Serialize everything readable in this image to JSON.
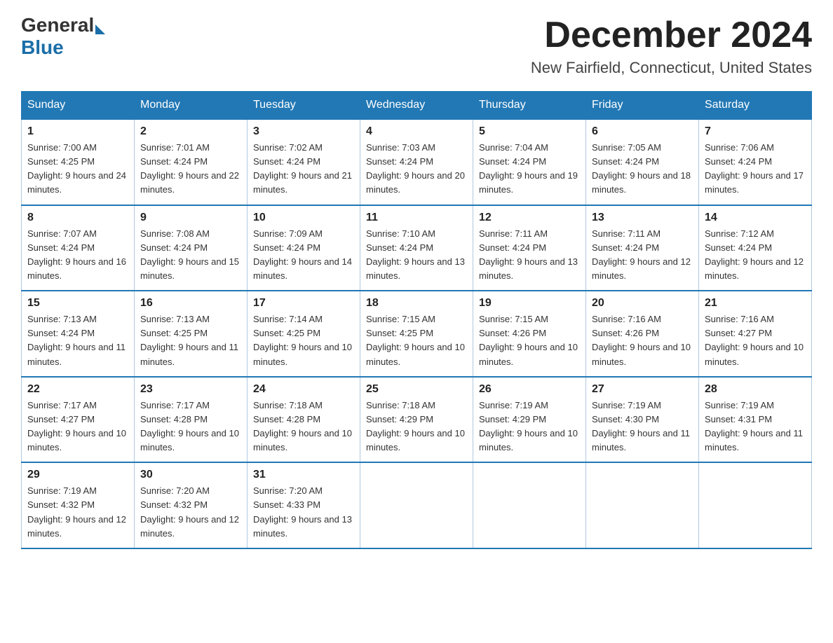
{
  "header": {
    "logo_general": "General",
    "logo_blue": "Blue",
    "month_title": "December 2024",
    "location": "New Fairfield, Connecticut, United States"
  },
  "days_of_week": [
    "Sunday",
    "Monday",
    "Tuesday",
    "Wednesday",
    "Thursday",
    "Friday",
    "Saturday"
  ],
  "weeks": [
    [
      {
        "day": "1",
        "sunrise": "7:00 AM",
        "sunset": "4:25 PM",
        "daylight": "9 hours and 24 minutes."
      },
      {
        "day": "2",
        "sunrise": "7:01 AM",
        "sunset": "4:24 PM",
        "daylight": "9 hours and 22 minutes."
      },
      {
        "day": "3",
        "sunrise": "7:02 AM",
        "sunset": "4:24 PM",
        "daylight": "9 hours and 21 minutes."
      },
      {
        "day": "4",
        "sunrise": "7:03 AM",
        "sunset": "4:24 PM",
        "daylight": "9 hours and 20 minutes."
      },
      {
        "day": "5",
        "sunrise": "7:04 AM",
        "sunset": "4:24 PM",
        "daylight": "9 hours and 19 minutes."
      },
      {
        "day": "6",
        "sunrise": "7:05 AM",
        "sunset": "4:24 PM",
        "daylight": "9 hours and 18 minutes."
      },
      {
        "day": "7",
        "sunrise": "7:06 AM",
        "sunset": "4:24 PM",
        "daylight": "9 hours and 17 minutes."
      }
    ],
    [
      {
        "day": "8",
        "sunrise": "7:07 AM",
        "sunset": "4:24 PM",
        "daylight": "9 hours and 16 minutes."
      },
      {
        "day": "9",
        "sunrise": "7:08 AM",
        "sunset": "4:24 PM",
        "daylight": "9 hours and 15 minutes."
      },
      {
        "day": "10",
        "sunrise": "7:09 AM",
        "sunset": "4:24 PM",
        "daylight": "9 hours and 14 minutes."
      },
      {
        "day": "11",
        "sunrise": "7:10 AM",
        "sunset": "4:24 PM",
        "daylight": "9 hours and 13 minutes."
      },
      {
        "day": "12",
        "sunrise": "7:11 AM",
        "sunset": "4:24 PM",
        "daylight": "9 hours and 13 minutes."
      },
      {
        "day": "13",
        "sunrise": "7:11 AM",
        "sunset": "4:24 PM",
        "daylight": "9 hours and 12 minutes."
      },
      {
        "day": "14",
        "sunrise": "7:12 AM",
        "sunset": "4:24 PM",
        "daylight": "9 hours and 12 minutes."
      }
    ],
    [
      {
        "day": "15",
        "sunrise": "7:13 AM",
        "sunset": "4:24 PM",
        "daylight": "9 hours and 11 minutes."
      },
      {
        "day": "16",
        "sunrise": "7:13 AM",
        "sunset": "4:25 PM",
        "daylight": "9 hours and 11 minutes."
      },
      {
        "day": "17",
        "sunrise": "7:14 AM",
        "sunset": "4:25 PM",
        "daylight": "9 hours and 10 minutes."
      },
      {
        "day": "18",
        "sunrise": "7:15 AM",
        "sunset": "4:25 PM",
        "daylight": "9 hours and 10 minutes."
      },
      {
        "day": "19",
        "sunrise": "7:15 AM",
        "sunset": "4:26 PM",
        "daylight": "9 hours and 10 minutes."
      },
      {
        "day": "20",
        "sunrise": "7:16 AM",
        "sunset": "4:26 PM",
        "daylight": "9 hours and 10 minutes."
      },
      {
        "day": "21",
        "sunrise": "7:16 AM",
        "sunset": "4:27 PM",
        "daylight": "9 hours and 10 minutes."
      }
    ],
    [
      {
        "day": "22",
        "sunrise": "7:17 AM",
        "sunset": "4:27 PM",
        "daylight": "9 hours and 10 minutes."
      },
      {
        "day": "23",
        "sunrise": "7:17 AM",
        "sunset": "4:28 PM",
        "daylight": "9 hours and 10 minutes."
      },
      {
        "day": "24",
        "sunrise": "7:18 AM",
        "sunset": "4:28 PM",
        "daylight": "9 hours and 10 minutes."
      },
      {
        "day": "25",
        "sunrise": "7:18 AM",
        "sunset": "4:29 PM",
        "daylight": "9 hours and 10 minutes."
      },
      {
        "day": "26",
        "sunrise": "7:19 AM",
        "sunset": "4:29 PM",
        "daylight": "9 hours and 10 minutes."
      },
      {
        "day": "27",
        "sunrise": "7:19 AM",
        "sunset": "4:30 PM",
        "daylight": "9 hours and 11 minutes."
      },
      {
        "day": "28",
        "sunrise": "7:19 AM",
        "sunset": "4:31 PM",
        "daylight": "9 hours and 11 minutes."
      }
    ],
    [
      {
        "day": "29",
        "sunrise": "7:19 AM",
        "sunset": "4:32 PM",
        "daylight": "9 hours and 12 minutes."
      },
      {
        "day": "30",
        "sunrise": "7:20 AM",
        "sunset": "4:32 PM",
        "daylight": "9 hours and 12 minutes."
      },
      {
        "day": "31",
        "sunrise": "7:20 AM",
        "sunset": "4:33 PM",
        "daylight": "9 hours and 13 minutes."
      },
      null,
      null,
      null,
      null
    ]
  ],
  "labels": {
    "sunrise_prefix": "Sunrise: ",
    "sunset_prefix": "Sunset: ",
    "daylight_prefix": "Daylight: "
  }
}
